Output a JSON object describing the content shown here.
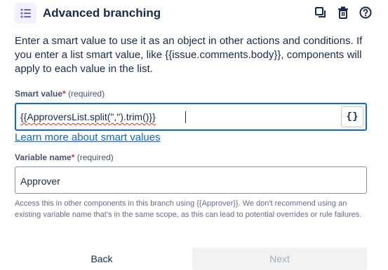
{
  "header": {
    "title": "Advanced branching",
    "icon": "list-icon",
    "icon_color": "#6e5dc6",
    "actions": [
      "copy-icon",
      "trash-icon",
      "help-icon"
    ]
  },
  "description": "Enter a smart value to use it as an object in other actions and conditions. If you enter a list smart value, like {{issue.comments.body}}, components will apply to each value in the list.",
  "smart_value": {
    "label": "Smart value",
    "required_star": "*",
    "required_text": "(required)",
    "value": "{{ApproversList.split(\",\").trim()}}",
    "brace_button": "{}",
    "link": "Learn more about smart values"
  },
  "variable_name": {
    "label": "Variable name",
    "required_star": "*",
    "required_text": "(required)",
    "value": "Approver",
    "helper": "Access this in other components in this branch using {{Approver}}. We don't recommend using an existing variable name that's in the same scope, as this can lead to potential overrides or rule failures."
  },
  "footer": {
    "back_label": "Back",
    "next_label": "Next"
  },
  "colors": {
    "focus_border": "#0c66e4",
    "link": "#0c66e4",
    "required": "#c9372c",
    "icon_bg": "#f3f0ff"
  }
}
